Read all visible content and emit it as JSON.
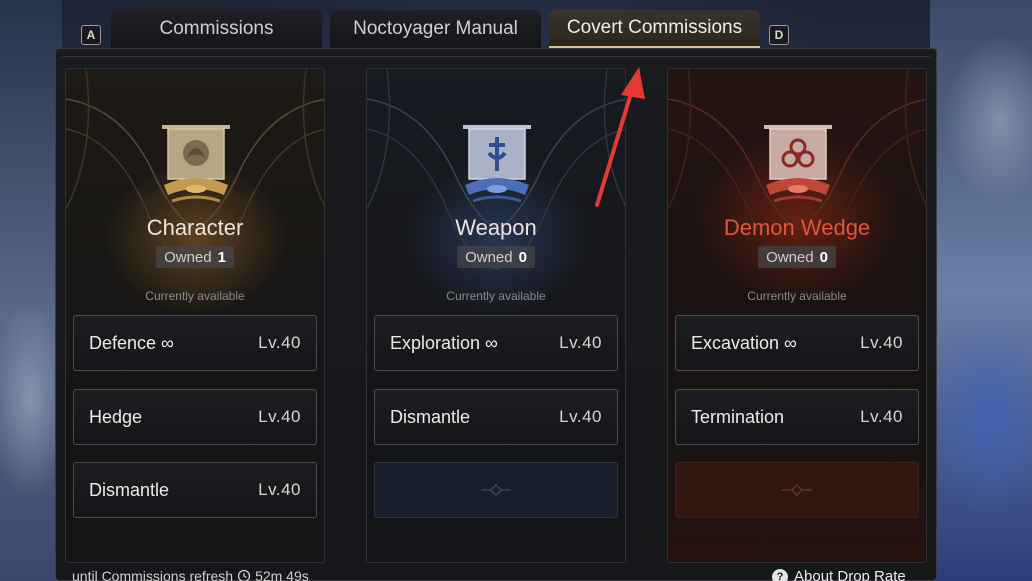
{
  "tabs": {
    "left_key": "A",
    "right_key": "D",
    "items": [
      {
        "label": "Commissions"
      },
      {
        "label": "Noctoyager Manual"
      },
      {
        "label": "Covert Commissions"
      }
    ]
  },
  "columns": [
    {
      "type": "Character",
      "owned_label": "Owned",
      "owned_count": "1",
      "availability": "Currently available",
      "slots": [
        {
          "name": "Defence ∞",
          "level": "Lv.40"
        },
        {
          "name": "Hedge",
          "level": "Lv.40"
        },
        {
          "name": "Dismantle",
          "level": "Lv.40"
        }
      ]
    },
    {
      "type": "Weapon",
      "owned_label": "Owned",
      "owned_count": "0",
      "availability": "Currently available",
      "slots": [
        {
          "name": "Exploration ∞",
          "level": "Lv.40"
        },
        {
          "name": "Dismantle",
          "level": "Lv.40"
        }
      ]
    },
    {
      "type": "Demon Wedge",
      "owned_label": "Owned",
      "owned_count": "0",
      "availability": "Currently available",
      "slots": [
        {
          "name": "Excavation ∞",
          "level": "Lv.40"
        },
        {
          "name": "Termination",
          "level": "Lv.40"
        }
      ]
    }
  ],
  "footer": {
    "refresh_text": "until Commissions refresh",
    "refresh_time": "52m 49s",
    "drop_rate_label": "About Drop Rate",
    "help_glyph": "?"
  },
  "colors": {
    "accent_gold": "#d9c49a",
    "demon_red": "#e0553c",
    "annotation_red": "#e53935"
  }
}
